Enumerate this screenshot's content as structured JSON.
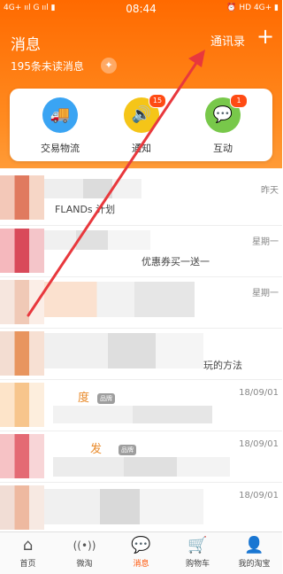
{
  "status_bar": {
    "left": "4G+ ııl G ııl ▮",
    "time": "08:44",
    "right": "⏰ HD 4G+ ▮"
  },
  "header": {
    "title": "消息",
    "unread": "195条未读消息",
    "clear_icon": "✦",
    "contacts": "通讯录",
    "add": "+"
  },
  "quick_actions": [
    {
      "label": "交易物流",
      "icon": "🚚",
      "color": "#3aa4f3",
      "badge": null
    },
    {
      "label": "通知",
      "icon": "🔊",
      "color": "#f5c518",
      "badge": "15"
    },
    {
      "label": "互动",
      "icon": "💬",
      "color": "#78c84a",
      "badge": "1"
    }
  ],
  "messages": [
    {
      "time": "昨天",
      "name": "",
      "preview": "FLANDs 计划",
      "tag": ""
    },
    {
      "time": "星期一",
      "name": "",
      "preview": "优惠券买一送一",
      "tag": ""
    },
    {
      "time": "星期一",
      "name": "",
      "preview": "",
      "tag": ""
    },
    {
      "time": "",
      "name": "",
      "preview": "玩的方法",
      "tag": ""
    },
    {
      "time": "18/09/01",
      "name": "度",
      "preview": "",
      "tag": "品牌"
    },
    {
      "time": "18/09/01",
      "name": "发",
      "preview": "",
      "tag": "品牌"
    },
    {
      "time": "18/09/01",
      "name": "",
      "preview": "",
      "tag": ""
    }
  ],
  "tabbar": [
    {
      "label": "首页",
      "icon": "⌂"
    },
    {
      "label": "微淘",
      "icon": "((•))"
    },
    {
      "label": "消息",
      "icon": "💬"
    },
    {
      "label": "购物车",
      "icon": "🛒"
    },
    {
      "label": "我的淘宝",
      "icon": "👤"
    }
  ],
  "colors": {
    "accent": "#ff6a00",
    "annotation": "#e8383d"
  }
}
